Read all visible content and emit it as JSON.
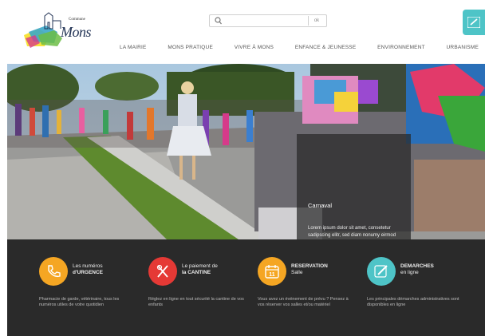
{
  "header": {
    "logo": {
      "commune": "Commune",
      "town": "Mons"
    },
    "search": {
      "placeholder": "",
      "submit_label": "ok"
    },
    "nav": [
      "LA MAIRIE",
      "MONS PRATIQUE",
      "VIVRE À MONS",
      "ENFANCE & JEUNESSE",
      "ENVIRONNEMENT",
      "URBANISME"
    ]
  },
  "hero": {
    "caption_title": "Carnaval",
    "caption_text": "Lorem ipsum dolor sit amet, consetetur sadipscing elitr, sed diam nonumy eirmod tempor invidunt ut labore et dolore magna",
    "more": "•••"
  },
  "quick_links": [
    {
      "line1": "Les numéros",
      "line2": "d'URGENCE",
      "desc": "Pharmacie de garde, vétérinaire, tous les numéros utiles de votre quotidien",
      "color": "#f5a623",
      "icon": "phone-icon"
    },
    {
      "line1": "Le paiement de",
      "line2": "la CANTINE",
      "desc": "Réglez en ligne en tout sécurité la cantine de vos enfants",
      "color": "#e53935",
      "icon": "cutlery-icon"
    },
    {
      "line1": "RESERVATION",
      "line2": "Salle",
      "desc": "Vous avez un événement de prévu ? Pensez à vos réserver vos salles et/ou matériel",
      "color": "#f5a623",
      "icon": "calendar-icon",
      "calendar_number": "11"
    },
    {
      "line1": "DEMARCHES",
      "line2": "en ligne",
      "desc": "Les principales démarches administratives sont disponibles en ligne",
      "color": "#4ec4c7",
      "icon": "pencil-icon"
    }
  ],
  "colors": {
    "accent_teal": "#4ec4c7",
    "panel_bg": "#2a2a2a"
  }
}
